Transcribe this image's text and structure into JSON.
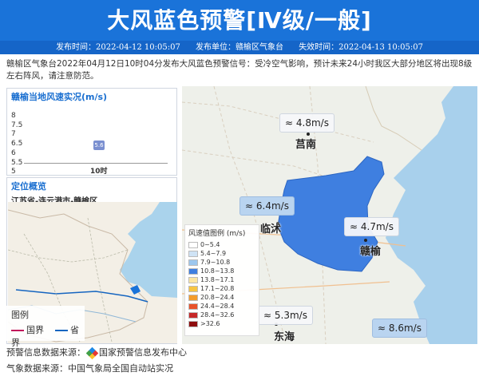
{
  "header": {
    "title": "大风蓝色预警[Ⅳ级/一般]",
    "publish_time": "发布时间：2022-04-12 10:05:07",
    "publisher": "发布单位：赣榆区气象台",
    "expire_time": "失效时间：2022-04-13 10:05:07"
  },
  "description": "赣榆区气象台2022年04月12日10时04分发布大风蓝色预警信号：受冷空气影响，预计未来24小时我区大部分地区将出现8级左右阵风，请注意防范。",
  "speed_panel": {
    "title": "赣榆当地风速实况(m/s)",
    "chart_data": {
      "type": "bar",
      "title": "赣榆当地风速实况(m/s)",
      "categories": [
        "10时"
      ],
      "values": [
        5.6
      ],
      "yticks": [
        "8",
        "7.5",
        "7",
        "6.5",
        "6",
        "5.5",
        "5"
      ],
      "ylim": [
        5,
        8
      ]
    },
    "value_label": "5.6",
    "x_label": "10时"
  },
  "location_panel": {
    "title": "定位概览",
    "region": "江苏省-连云港市-赣榆区",
    "legend_title": "图例",
    "legend_items": [
      {
        "label": "国界",
        "color": "#c2185b"
      },
      {
        "label": "省界",
        "color": "#1565c0"
      }
    ]
  },
  "map": {
    "stations": [
      {
        "speed": "4.8m/s",
        "city": "莒南",
        "highlight": false
      },
      {
        "speed": "6.4m/s",
        "city": "临沭",
        "highlight": true
      },
      {
        "speed": "4.7m/s",
        "city": "赣榆",
        "highlight": false
      },
      {
        "speed": "5.3m/s",
        "city": "东海",
        "highlight": false
      },
      {
        "speed": "8.6m/s",
        "city": "",
        "highlight": true
      }
    ],
    "legend": {
      "title": "风速值图例 (m/s)",
      "items": [
        {
          "label": "0~5.4",
          "color": "#ffffff"
        },
        {
          "label": "5.4~7.9",
          "color": "#cfe3f5"
        },
        {
          "label": "7.9~10.8",
          "color": "#9cc7ee"
        },
        {
          "label": "10.8~13.8",
          "color": "#3f7fe0"
        },
        {
          "label": "13.8~17.1",
          "color": "#fbe6a2"
        },
        {
          "label": "17.1~20.8",
          "color": "#f7c542"
        },
        {
          "label": "20.8~24.4",
          "color": "#f39c2b"
        },
        {
          "label": "24.4~28.4",
          "color": "#e8522a"
        },
        {
          "label": "28.4~32.6",
          "color": "#c62828"
        },
        {
          "label": ">32.6",
          "color": "#8e0e0e"
        }
      ]
    }
  },
  "footer": {
    "warning_source": "预警信息数据来源：",
    "warning_source_name": "国家预警信息发布中心",
    "weather_source": "气象数据来源：中国气象局全国自动站实况"
  },
  "colors": {
    "header_blue": "#1a73d9",
    "warning_area": "#3f7fe0"
  }
}
